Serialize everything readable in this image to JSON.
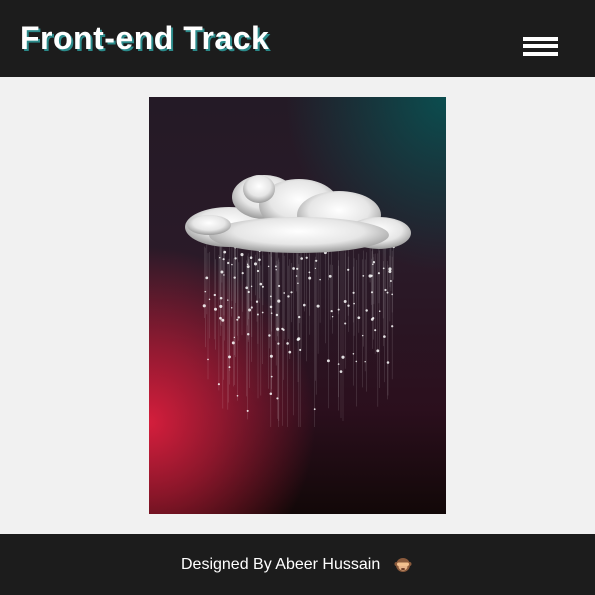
{
  "header": {
    "title": "Front-end Track",
    "menu_icon": "hamburger-menu-icon"
  },
  "main": {
    "artwork_icon": "rain-cloud-artwork",
    "colors": {
      "teal": "#0b4d4f",
      "crimson": "#d41e3c",
      "dark": "#1c1c1c"
    }
  },
  "footer": {
    "credit": "Designed By Abeer Hussain",
    "emoji_icon": "see-no-evil-monkey-icon"
  }
}
